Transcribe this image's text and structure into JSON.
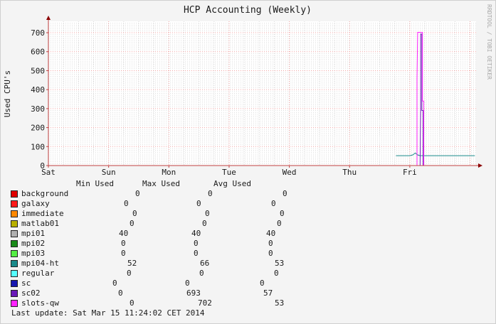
{
  "title": "HCP Accounting (Weekly)",
  "watermark": "RRDTOOL / TOBI OETIKER",
  "ylabel": "Used CPU's",
  "legend_header": {
    "min": "Min Used",
    "max": "Max Used",
    "avg": "Avg Used"
  },
  "legend": [
    {
      "name": "background",
      "color": "#e00000",
      "min": "0",
      "max": "0",
      "avg": "0"
    },
    {
      "name": "galaxy",
      "color": "#ff1a1a",
      "min": "0",
      "max": "0",
      "avg": "0"
    },
    {
      "name": "immediate",
      "color": "#ff8800",
      "min": "0",
      "max": "0",
      "avg": "0"
    },
    {
      "name": "matlab01",
      "color": "#b8b000",
      "min": "0",
      "max": "0",
      "avg": "0"
    },
    {
      "name": "mpi01",
      "color": "#b0b0b0",
      "min": "40",
      "max": "40",
      "avg": "40"
    },
    {
      "name": "mpi02",
      "color": "#1a8a1a",
      "min": "0",
      "max": "0",
      "avg": "0"
    },
    {
      "name": "mpi03",
      "color": "#55ee44",
      "min": "0",
      "max": "0",
      "avg": "0"
    },
    {
      "name": "mpi04-ht",
      "color": "#1a8a8a",
      "min": "52",
      "max": "66",
      "avg": "53"
    },
    {
      "name": "regular",
      "color": "#55ffff",
      "min": "0",
      "max": "0",
      "avg": "0"
    },
    {
      "name": "sc",
      "color": "#1818b0",
      "min": "0",
      "max": "0",
      "avg": "0"
    },
    {
      "name": "sc02",
      "color": "#6a1ab8",
      "min": "0",
      "max": "693",
      "avg": "57"
    },
    {
      "name": "slots-qw",
      "color": "#ff22ff",
      "min": "0",
      "max": "702",
      "avg": "53"
    }
  ],
  "last_update": "Last update: Sat Mar 15 11:24:02 CET 2014",
  "chart_data": {
    "type": "line",
    "title": "HCP Accounting (Weekly)",
    "ylabel": "Used CPU's",
    "xlabel": "",
    "categories": [
      "Sat",
      "Sun",
      "Mon",
      "Tue",
      "Wed",
      "Thu",
      "Fri"
    ],
    "ylim": [
      0,
      760
    ],
    "xlim": [
      0,
      7.1
    ],
    "yticks": [
      0,
      100,
      200,
      300,
      400,
      500,
      600,
      700
    ],
    "grid": true,
    "series": [
      {
        "name": "mpi04-ht",
        "color": "#1a8a8a",
        "points": [
          [
            5.77,
            52
          ],
          [
            6.0,
            52
          ],
          [
            6.05,
            56
          ],
          [
            6.09,
            66
          ],
          [
            6.13,
            56
          ],
          [
            6.17,
            52
          ],
          [
            7.08,
            52
          ]
        ]
      },
      {
        "name": "sc02",
        "color": "#6a1ab8",
        "points": [
          [
            6.15,
            0
          ],
          [
            6.17,
            0
          ],
          [
            6.18,
            290
          ],
          [
            6.18,
            693
          ],
          [
            6.2,
            693
          ],
          [
            6.2,
            290
          ],
          [
            6.22,
            290
          ],
          [
            6.22,
            0
          ],
          [
            6.24,
            0
          ]
        ]
      },
      {
        "name": "slots-qw",
        "color": "#ff22ff",
        "points": [
          [
            6.12,
            0
          ],
          [
            6.12,
            460
          ],
          [
            6.13,
            702
          ],
          [
            6.21,
            702
          ],
          [
            6.21,
            340
          ],
          [
            6.23,
            340
          ],
          [
            6.23,
            0
          ],
          [
            6.25,
            0
          ]
        ]
      }
    ]
  }
}
